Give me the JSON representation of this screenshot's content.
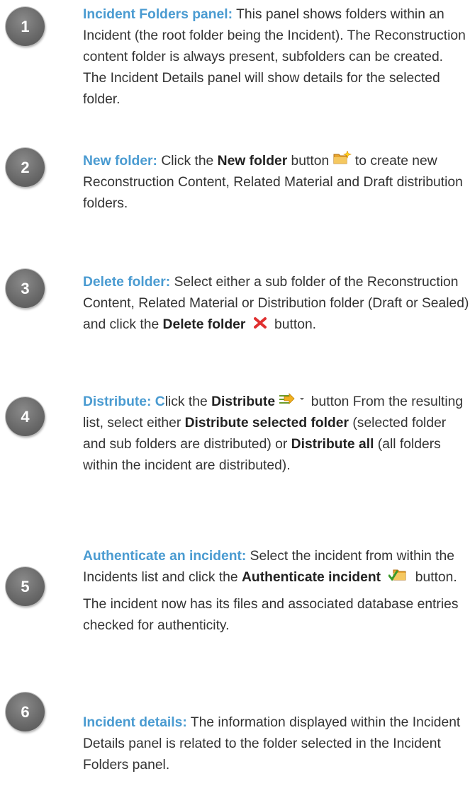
{
  "items": [
    {
      "number": "1",
      "heading": "Incident Folders panel:",
      "text": " This panel shows folders within an Incident (the root folder being the Incident). The Reconstruction content folder is always present, subfolders can be created. The Incident Details panel will show details for the selected folder."
    },
    {
      "number": "2",
      "heading": "New folder:",
      "pre": " Click the ",
      "bold": "New folder",
      "mid": " button ",
      "icon": "new-folder-icon",
      "post": " to create new Reconstruction Content, Related Material and Draft distribution folders."
    },
    {
      "number": "3",
      "heading": "Delete folder:",
      "pre": " Select either a sub folder of the Reconstruction Content, Related Material or Distribution folder (Draft or Sealed) and click the ",
      "bold": "Delete folder",
      "icon": "delete-icon",
      "post": " button."
    },
    {
      "number": "4",
      "heading": "Distribute: C",
      "pre": "lick the ",
      "bold": "Distribute",
      "icon": "distribute-icon",
      "mid": " button From the resulting list, select either ",
      "bold2": "Distribute selected folder",
      "mid2": " (selected folder and sub folders are distributed) or ",
      "bold3": "Distribute all",
      "post": " (all folders within the incident are distributed)."
    },
    {
      "number": "5",
      "heading": "Authenticate an incident:",
      "pre": " Select the incident from within the Incidents list and click the ",
      "bold": "Authenticate incident",
      "icon": "authenticate-icon",
      "post": " button.",
      "para2": "The incident now has its files and associated database entries checked for authenticity."
    },
    {
      "number": "6",
      "heading": "Incident details:",
      "text": " The information displayed within the Incident Details panel is related to the folder selected in the Incident Folders panel."
    }
  ],
  "colors": {
    "heading": "#4a9bd1",
    "body": "#333333",
    "delete": "#e03030"
  }
}
